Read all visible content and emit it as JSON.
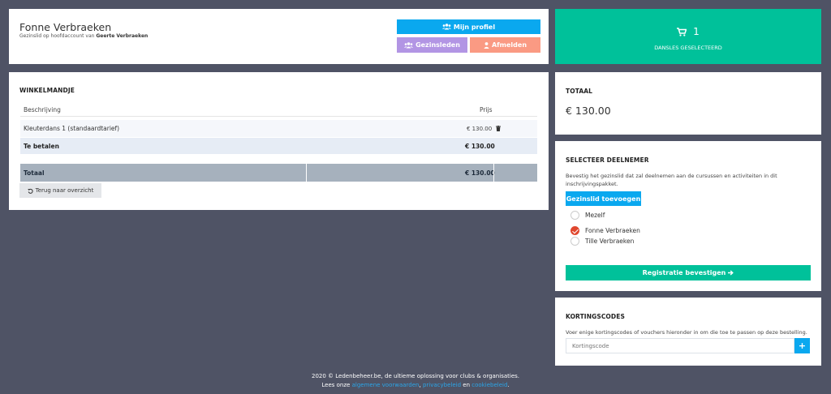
{
  "header": {
    "name": "Fonne Verbraeken",
    "subtitle_prefix": "Gezinslid op hoofdaccount van",
    "subtitle_owner": "Geerte Verbraeken",
    "btn_profile": "Mijn profiel",
    "btn_family": "Gezinsleden",
    "btn_logout": "Afmelden"
  },
  "cart_summary": {
    "count": "1",
    "label": "DANSLES GESELECTEERD"
  },
  "basket": {
    "title": "WINKELMANDJE",
    "col_description": "Beschrijving",
    "col_price": "Prijs",
    "items": [
      {
        "description": "Kleuterdans 1 (standaardtarief)",
        "price": "€ 130.00"
      }
    ],
    "to_pay_label": "Te betalen",
    "to_pay_value": "€ 130.00",
    "total_label": "Totaal",
    "total_value": "€ 130.00",
    "back_button": "Terug naar overzicht"
  },
  "total_card": {
    "title": "TOTAAL",
    "amount": "€ 130.00"
  },
  "participant": {
    "title": "SELECTEER DEELNEMER",
    "description": "Bevestig het gezinslid dat zal deelnemen aan de cursussen en activiteiten in dit inschrijvingspakket.",
    "add_button": "Gezinslid toevoegen",
    "options": [
      {
        "label": "Mezelf",
        "checked": false
      },
      {
        "label": "Fonne Verbraeken",
        "checked": true
      },
      {
        "label": "Tille Verbraeken",
        "checked": false
      }
    ],
    "confirm_button": "Registratie bevestigen"
  },
  "discount": {
    "title": "KORTINGSCODES",
    "description": "Voer enige kortingscodes of vouchers hieronder in om die toe te passen op deze bestelling.",
    "placeholder": "Kortingscode",
    "add_symbol": "+"
  },
  "footer": {
    "line1": "2020 © Ledenbeheer.be, de ultieme oplossing voor clubs & organisaties.",
    "read_prefix": "Lees onze",
    "link1": "algemene voorwaarden",
    "sep1": ",",
    "link2": "privacybeleid",
    "sep2": "en",
    "link3": "cookiebeleid",
    "end": "."
  },
  "colors": {
    "page_bg": "#4f5365",
    "blue": "#0aa8ef",
    "purple": "#b295e4",
    "salmon": "#fa9a83",
    "green": "#00c19a",
    "gray_bar": "#a6b1bd",
    "light_row": "#e6ecf5"
  }
}
